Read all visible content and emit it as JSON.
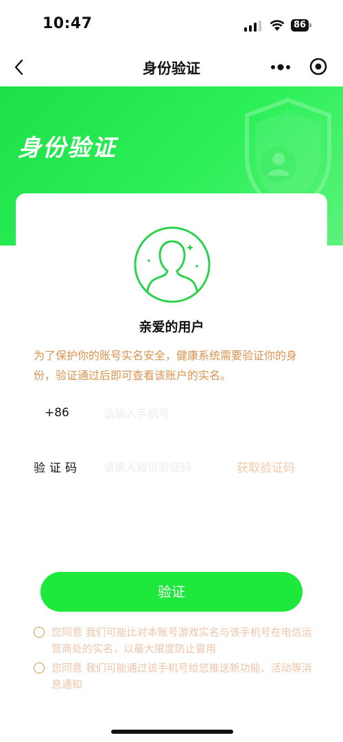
{
  "status_bar": {
    "time": "10:47",
    "battery": "86"
  },
  "nav": {
    "title": "身份验证"
  },
  "hero": {
    "title": "身份验证"
  },
  "card": {
    "greeting": "亲爱的用户",
    "notice": "为了保护你的账号实名安全，健康系统需要验证你的身份，验证通过后即可查看该账户的实名。",
    "phone_prefix": "+86",
    "phone_placeholder": "请输入手机号",
    "code_label": "验证码",
    "code_placeholder": "请输入短信验证码",
    "get_code": "获取验证码",
    "verify_button": "验证",
    "agreements": [
      "您同意 我们可能比对本账号游戏实名与该手机号在电信运营商处的实名，以最大限度防止冒用",
      "您同意 我们可能通过该手机号给您推送新功能、活动等消息通知"
    ]
  },
  "colors": {
    "accent_green": "#1ee83c",
    "notice_orange": "#d9934f",
    "muted_orange": "#f3c9a7"
  },
  "icons": [
    "back-icon",
    "more-icon",
    "target-icon",
    "shield-icon",
    "user-avatar-icon",
    "signal-icon",
    "wifi-icon",
    "battery-icon"
  ]
}
